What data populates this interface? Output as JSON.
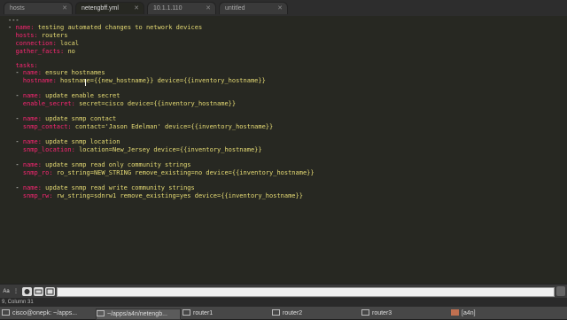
{
  "tabs": [
    {
      "label": "hosts",
      "active": false
    },
    {
      "label": "netengbff.yml",
      "active": true
    },
    {
      "label": "10.1.1.110",
      "active": false
    },
    {
      "label": "untitled",
      "active": false
    }
  ],
  "code": {
    "l1": "---",
    "l2_name": "name:",
    "l2_val": "testing automated changes to network devices",
    "l3_k": "hosts:",
    "l3_v": "routers",
    "l4_k": "connection:",
    "l4_v": "local",
    "l5_k": "gather_facts:",
    "l5_v": "no",
    "l6_k": "tasks:",
    "t1_name_k": "name:",
    "t1_name_v": "ensure hostnames",
    "t1_mod": "hostname:",
    "t1_args": "hostname={{new_hostname}} device={{inventory_hostname}}",
    "t2_name_k": "name:",
    "t2_name_v": "update enable secret",
    "t2_mod": "enable_secret:",
    "t2_args": "secret=cisco device={{inventory_hostname}}",
    "t3_name_k": "name:",
    "t3_name_v": "update snmp contact",
    "t3_mod": "snmp_contact:",
    "t3_args": "contact='Jason Edelman' device={{inventory_hostname}}",
    "t4_name_k": "name:",
    "t4_name_v": "update snmp location",
    "t4_mod": "snmp_location:",
    "t4_args": "location=New_Jersey device={{inventory_hostname}}",
    "t5_name_k": "name:",
    "t5_name_v": "update snmp read only community strings",
    "t5_mod": "snmp_ro:",
    "t5_args": "ro_string=NEW_STRING remove_existing=no device={{inventory_hostname}}",
    "t6_name_k": "name:",
    "t6_name_v": "update snmp read write community strings",
    "t6_mod": "snmp_rw:",
    "t6_args": "rw_string=sdnrw1 remove_existing=yes device={{inventory_hostname}}"
  },
  "findbar": {
    "case_label": "Aa",
    "input_value": ""
  },
  "status": "9, Column 31",
  "taskbar": [
    {
      "label": "cisco@onepk: ~/apps..."
    },
    {
      "label": "~/apps/a4n/netengb..."
    },
    {
      "label": "router1"
    },
    {
      "label": "router2"
    },
    {
      "label": "router3"
    },
    {
      "label": "[a4n]"
    }
  ],
  "colors": {
    "editor_bg": "#272822",
    "keyword": "#f92672",
    "string": "#e6db74"
  }
}
